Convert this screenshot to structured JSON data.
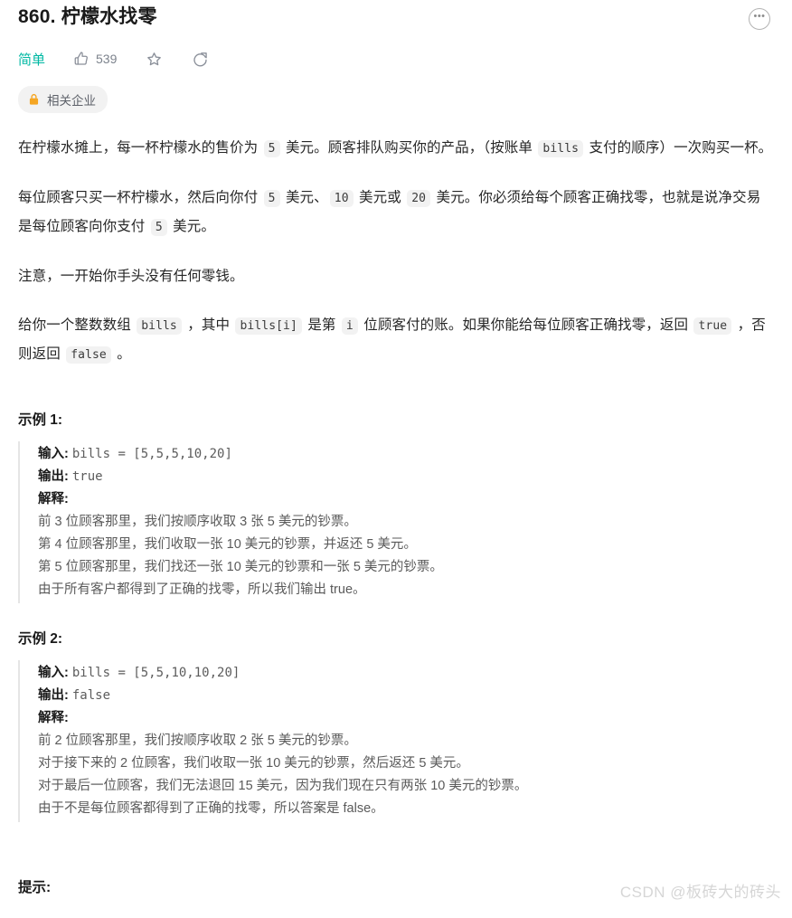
{
  "header": {
    "title": "860. 柠檬水找零",
    "more_icon": "ellipsis-icon",
    "dots": "•••"
  },
  "meta": {
    "difficulty": "简单",
    "like_count": "539",
    "like_icon": "thumbs-up-icon",
    "star_icon": "star-icon",
    "share_icon": "share-icon"
  },
  "badge": {
    "lock_icon": "lock-icon",
    "label": "相关企业"
  },
  "description": {
    "p1": {
      "t1": "在柠檬水摊上，每一杯柠檬水的售价为 ",
      "c1": "5",
      "t2": " 美元。顾客排队购买你的产品，（按账单 ",
      "c2": "bills",
      "t3": " 支付的顺序）一次购买一杯。"
    },
    "p2": {
      "t1": "每位顾客只买一杯柠檬水，然后向你付 ",
      "c1": "5",
      "t2": " 美元、",
      "c2": "10",
      "t3": " 美元或 ",
      "c3": "20",
      "t4": " 美元。你必须给每个顾客正确找零，也就是说净交易是每位顾客向你支付 ",
      "c4": "5",
      "t5": " 美元。"
    },
    "p3": {
      "t1": "注意，一开始你手头没有任何零钱。"
    },
    "p4": {
      "t1": "给你一个整数数组 ",
      "c1": "bills",
      "t2": " ，其中 ",
      "c2": "bills[i]",
      "t3": " 是第 ",
      "c3": "i",
      "t4": " 位顾客付的账。如果你能给每位顾客正确找零，返回 ",
      "c4": "true",
      "t5": " ，否则返回 ",
      "c5": "false",
      "t6": " 。"
    }
  },
  "examples": [
    {
      "heading": "示例 1:",
      "input_label": "输入:",
      "input_value": "bills = [5,5,5,10,20]",
      "output_label": "输出:",
      "output_value": "true",
      "explain_label": "解释:",
      "explain_lines": [
        "前 3 位顾客那里，我们按顺序收取 3 张 5 美元的钞票。",
        "第 4 位顾客那里，我们收取一张 10 美元的钞票，并返还 5 美元。",
        "第 5 位顾客那里，我们找还一张 10 美元的钞票和一张 5 美元的钞票。",
        "由于所有客户都得到了正确的找零，所以我们输出 true。"
      ]
    },
    {
      "heading": "示例 2:",
      "input_label": "输入:",
      "input_value": "bills = [5,5,10,10,20]",
      "output_label": "输出:",
      "output_value": "false",
      "explain_label": "解释:",
      "explain_lines": [
        "前 2 位顾客那里，我们按顺序收取 2 张 5 美元的钞票。",
        "对于接下来的 2 位顾客，我们收取一张 10 美元的钞票，然后返还 5 美元。",
        "对于最后一位顾客，我们无法退回 15 美元，因为我们现在只有两张 10 美元的钞票。",
        "由于不是每位顾客都得到了正确的找零，所以答案是 false。"
      ]
    }
  ],
  "hints": {
    "heading": "提示:"
  },
  "watermark": {
    "text": "CSDN @板砖大的砖头"
  },
  "colors": {
    "difficulty": "#00b8a3",
    "lock": "#f5a623",
    "code_bg": "#f2f2f2",
    "border": "#e5e5e5"
  }
}
